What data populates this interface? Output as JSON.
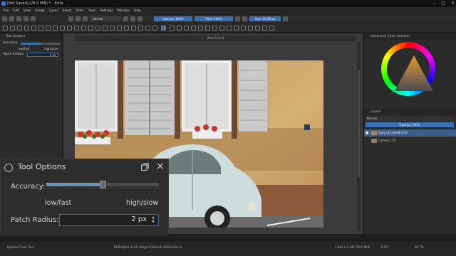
{
  "window": {
    "title": "[Not Saved]  (28.0 MiB)  * – Krita",
    "controls": [
      "–",
      "□",
      "×"
    ]
  },
  "menu": [
    "File",
    "Edit",
    "View",
    "Image",
    "Layer",
    "Select",
    "Filter",
    "Tools",
    "Settings",
    "Window",
    "Help"
  ],
  "toolbar": {
    "blend_mode": "Normal",
    "opacity": "Opacity: 100%",
    "flow": "Flow: 100%",
    "size": "Size: 30.00 px"
  },
  "left_dock": {
    "title": "Tool Options",
    "accuracy_label": "Accuracy:",
    "low_label": "low/fast",
    "high_label": "high/slow",
    "patch_radius_label": "Patch Radius:",
    "patch_radius_value": "2 px",
    "accuracy_level_percent": 50
  },
  "canvas": {
    "tab_title": "[Not Saved]"
  },
  "right_dock": {
    "color_selector_title": "Advanced Color Selector",
    "layers_title": "Layers",
    "layer_blend": "Normal",
    "layer_opacity": "Opacity: 100%",
    "layers": [
      {
        "name": "Copy of Clone6.2 CV",
        "selected": true
      },
      {
        "name": "Clone6.2 CV",
        "selected": false
      }
    ]
  },
  "status": {
    "tool": "Ryb/ook Clone Tool",
    "color": "RGB/Alpha (8-bit integer/channel)  sRGB-built-in",
    "dims": "1,962 x 1,342 (28.0 MiB)",
    "rotation": "0.00°",
    "zoom": "66.7%"
  },
  "popup": {
    "title": "Tool Options",
    "accuracy_label": "Accuracy:",
    "low_label": "low/fast",
    "high_label": "high/slow",
    "patch_radius_label": "Patch Radius:",
    "patch_radius_value": "2 px",
    "accuracy_level_percent": 50
  },
  "colors": {
    "accent": "#3d6fb4",
    "panel": "#2b2b2b",
    "background": "#1e1e1e"
  }
}
